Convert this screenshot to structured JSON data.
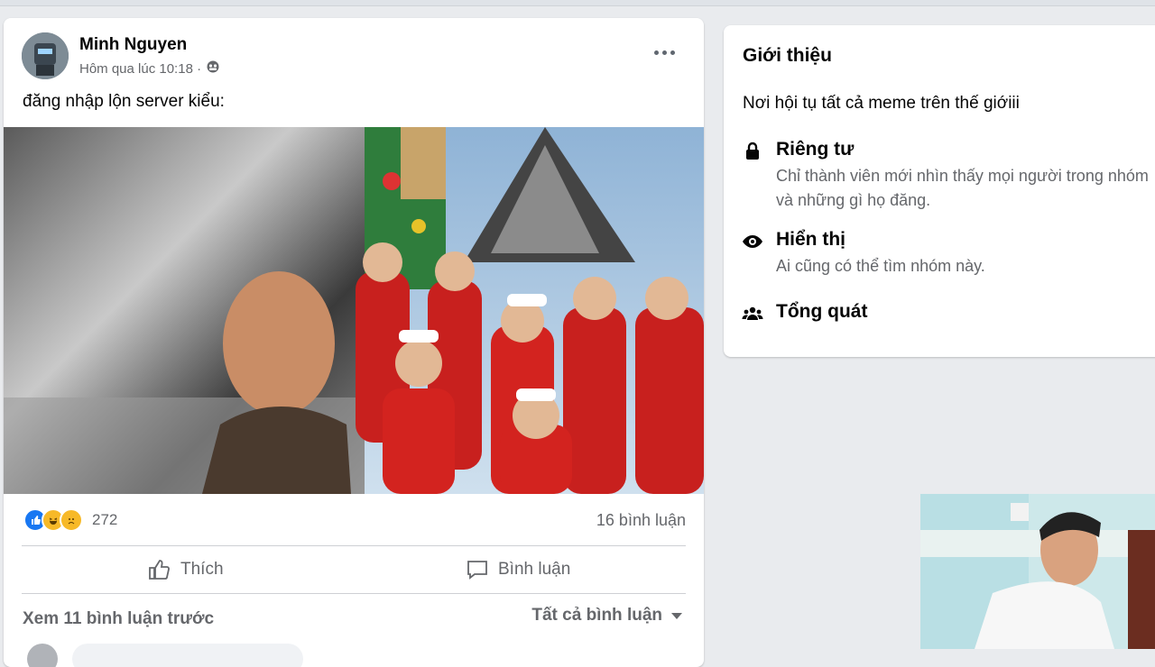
{
  "post": {
    "author": "Minh Nguyen",
    "timestamp": "Hôm qua lúc 10:18 ·",
    "audience_icon": "group-audience-icon",
    "text": "đăng nhập lộn server kiểu:",
    "photo_description": "",
    "reactions": {
      "icons": [
        "like",
        "haha",
        "sad"
      ],
      "count": "272"
    },
    "comment_count": "16 bình luận",
    "actions": {
      "like": "Thích",
      "comment": "Bình luận"
    },
    "view_previous": "Xem 11 bình luận trước",
    "all_comments": "Tất cả bình luận"
  },
  "about": {
    "title": "Giới thiệu",
    "description": "Nơi hội tụ tất cả meme trên thế giớiii",
    "items": [
      {
        "icon": "lock-icon",
        "title": "Riêng tư",
        "desc": "Chỉ thành viên mới nhìn thấy mọi người trong nhóm và những gì họ đăng."
      },
      {
        "icon": "eye-icon",
        "title": "Hiển thị",
        "desc": "Ai cũng có thể tìm nhóm này."
      },
      {
        "icon": "people-icon",
        "title": "Tổng quát",
        "desc": ""
      }
    ]
  },
  "colors": {
    "background": "#e9ebee",
    "card": "#ffffff",
    "secondary_text": "#65676b",
    "like_blue": "#1877f2",
    "haha_yellow": "#f7b928"
  }
}
